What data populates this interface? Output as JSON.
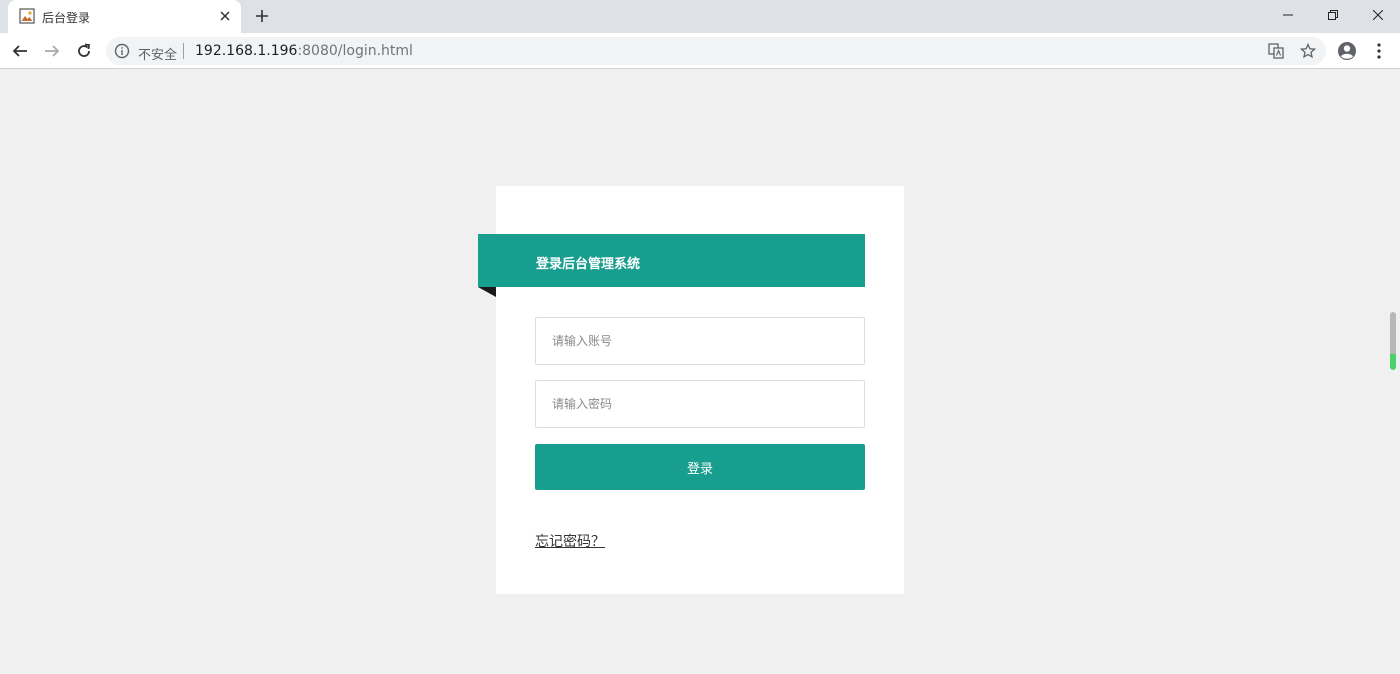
{
  "browser": {
    "tab": {
      "title": "后台登录",
      "favicon": "image-icon"
    },
    "new_tab_label": "+",
    "address_bar": {
      "security_label": "不安全",
      "host": "192.168.1.196",
      "rest": ":8080/login.html"
    },
    "window_controls": [
      "minimize",
      "restore",
      "close"
    ]
  },
  "login": {
    "header_title": "登录后台管理系统",
    "username_placeholder": "请输入账号",
    "password_placeholder": "请输入密码",
    "submit_label": "登录",
    "forgot_label": "忘记密码？"
  },
  "colors": {
    "accent": "#189e8f",
    "page_bg": "#f0f0f0",
    "card_bg": "#ffffff"
  }
}
